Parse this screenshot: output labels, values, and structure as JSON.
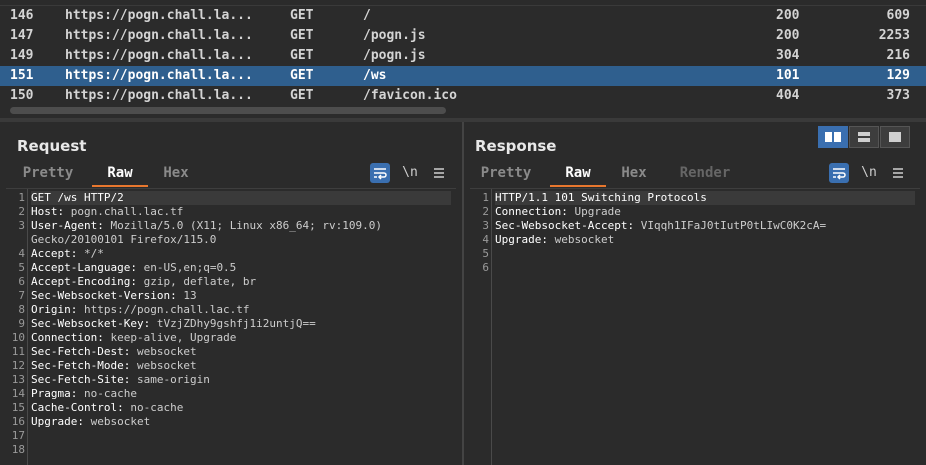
{
  "history": {
    "rows": [
      {
        "num": "146",
        "host": "https://pogn.chall.la...",
        "method": "GET",
        "path": "/",
        "status": "200",
        "length": "609",
        "selected": false
      },
      {
        "num": "147",
        "host": "https://pogn.chall.la...",
        "method": "GET",
        "path": "/pogn.js",
        "status": "200",
        "length": "2253",
        "selected": false
      },
      {
        "num": "149",
        "host": "https://pogn.chall.la...",
        "method": "GET",
        "path": "/pogn.js",
        "status": "304",
        "length": "216",
        "selected": false
      },
      {
        "num": "151",
        "host": "https://pogn.chall.la...",
        "method": "GET",
        "path": "/ws",
        "status": "101",
        "length": "129",
        "selected": true
      },
      {
        "num": "150",
        "host": "https://pogn.chall.la...",
        "method": "GET",
        "path": "/favicon.ico",
        "status": "404",
        "length": "373",
        "selected": false
      }
    ]
  },
  "request": {
    "title": "Request",
    "tabs": [
      "Pretty",
      "Raw",
      "Hex"
    ],
    "active_tab": "Raw",
    "line_numbers": [
      "1",
      "2",
      "3",
      "",
      "4",
      "5",
      "6",
      "7",
      "8",
      "9",
      "10",
      "11",
      "12",
      "13",
      "14",
      "15",
      "16",
      "17",
      "18"
    ],
    "lines": [
      {
        "key": "GET /ws HTTP/2",
        "val": ""
      },
      {
        "key": "Host:",
        "val": " pogn.chall.lac.tf"
      },
      {
        "key": "User-Agent:",
        "val": " Mozilla/5.0 (X11; Linux x86_64; rv:109.0)"
      },
      {
        "key": "",
        "val": "Gecko/20100101 Firefox/115.0"
      },
      {
        "key": "Accept:",
        "val": " */*"
      },
      {
        "key": "Accept-Language:",
        "val": " en-US,en;q=0.5"
      },
      {
        "key": "Accept-Encoding:",
        "val": " gzip, deflate, br"
      },
      {
        "key": "Sec-Websocket-Version:",
        "val": " 13"
      },
      {
        "key": "Origin:",
        "val": " https://pogn.chall.lac.tf"
      },
      {
        "key": "Sec-Websocket-Key:",
        "val": " tVzjZDhy9gshfj1i2untjQ=="
      },
      {
        "key": "Connection:",
        "val": " keep-alive, Upgrade"
      },
      {
        "key": "Sec-Fetch-Dest:",
        "val": " websocket"
      },
      {
        "key": "Sec-Fetch-Mode:",
        "val": " websocket"
      },
      {
        "key": "Sec-Fetch-Site:",
        "val": " same-origin"
      },
      {
        "key": "Pragma:",
        "val": " no-cache"
      },
      {
        "key": "Cache-Control:",
        "val": " no-cache"
      },
      {
        "key": "Upgrade:",
        "val": " websocket"
      },
      {
        "key": "",
        "val": ""
      },
      {
        "key": "",
        "val": ""
      }
    ]
  },
  "response": {
    "title": "Response",
    "tabs": [
      "Pretty",
      "Raw",
      "Hex",
      "Render"
    ],
    "active_tab": "Raw",
    "line_numbers": [
      "1",
      "2",
      "3",
      "4",
      "5",
      "6"
    ],
    "lines": [
      {
        "key": "HTTP/1.1 101 Switching Protocols",
        "val": ""
      },
      {
        "key": "Connection:",
        "val": " Upgrade"
      },
      {
        "key": "Sec-Websocket-Accept:",
        "val": " VIqqh1IFaJ0tIutP0tLIwC0K2cA="
      },
      {
        "key": "Upgrade:",
        "val": " websocket"
      },
      {
        "key": "",
        "val": ""
      },
      {
        "key": "",
        "val": ""
      }
    ]
  },
  "tools": {
    "newline_label": "\\n"
  },
  "colors": {
    "selected_row": "#2f5f8e",
    "active_tab_underline": "#e8772e",
    "toggle_on": "#3a6fb0"
  }
}
